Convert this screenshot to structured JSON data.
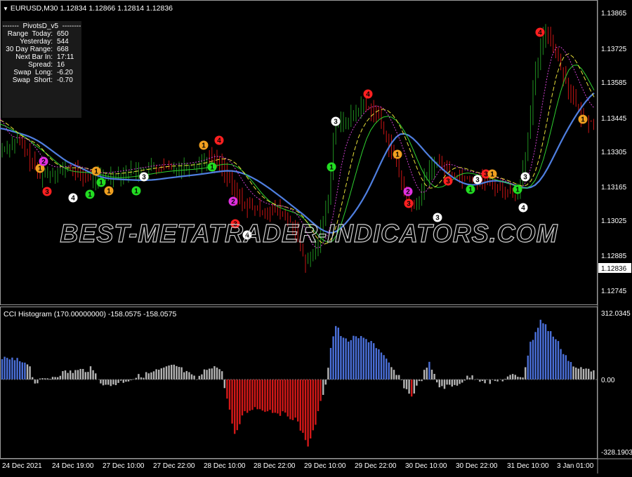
{
  "header": {
    "symbol_line": "EURUSD,M30  1.12834 1.12866 1.12814 1.12836"
  },
  "pivots_panel": {
    "title": "-------  PivotsD_v5  --------",
    "rows": [
      {
        "label": "Range  Today:",
        "value": "650"
      },
      {
        "label": "Yesterday:",
        "value": "544"
      },
      {
        "label": "30 Day Range:",
        "value": "668"
      },
      {
        "label": "Next Bar In:",
        "value": "17:11"
      },
      {
        "label": "Spread:",
        "value": "16"
      },
      {
        "label": "Swap  Long:",
        "value": "-6.20"
      },
      {
        "label": "Swap  Short:",
        "value": "-0.70"
      }
    ]
  },
  "watermark": "BEST-METATRADER-INDICATORS.COM",
  "price_axis": {
    "labels": [
      "1.13865",
      "1.13725",
      "1.13585",
      "1.13445",
      "1.13305",
      "1.13165",
      "1.13025",
      "1.12885",
      "1.12745"
    ],
    "current_price": "1.12836"
  },
  "cci_panel": {
    "header": "CCI Histogram (170.00000000) -158.0575 -158.0575",
    "axis_labels": [
      "312.0345",
      "0.00",
      "-328.1903"
    ]
  },
  "time_axis": {
    "labels": [
      "24 Dec 2021",
      "24 Dec 19:00",
      "27 Dec 10:00",
      "27 Dec 22:00",
      "28 Dec 10:00",
      "28 Dec 22:00",
      "29 Dec 10:00",
      "29 Dec 22:00",
      "30 Dec 10:00",
      "30 Dec 22:00",
      "31 Dec 10:00",
      "3 Jan 01:00"
    ]
  },
  "colors": {
    "background": "#000000",
    "bull_candle": "#1f8f1f",
    "bear_candle": "#c81414",
    "ma_blue": "#4f7fe0",
    "ma_green": "#2fd02f",
    "ma_yellow": "#e8e03a",
    "ma_magenta": "#d040d0",
    "cci_positive": "#4a6fd8",
    "cci_neutral": "#b4b4b4",
    "cci_negative": "#d21818",
    "watermark_stroke": "#cfcfcf"
  },
  "markers": [
    {
      "label": "1",
      "color": "#f0a020",
      "text_color": "#000"
    },
    {
      "label": "1",
      "color": "#22dd22",
      "text_color": "#000"
    },
    {
      "label": "3",
      "color": "#ff2020",
      "text_color": "#000"
    },
    {
      "label": "3",
      "color": "#ffffff",
      "text_color": "#000"
    },
    {
      "label": "4",
      "color": "#ff2020",
      "text_color": "#000"
    },
    {
      "label": "4",
      "color": "#ffffff",
      "text_color": "#000"
    },
    {
      "label": "2",
      "color": "#e030e0",
      "text_color": "#000"
    }
  ]
}
